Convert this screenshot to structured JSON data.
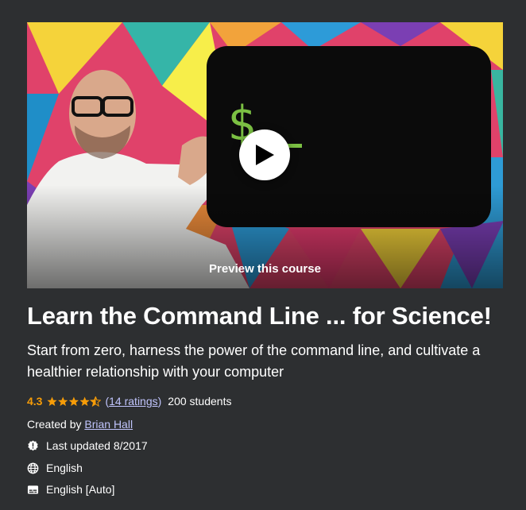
{
  "preview": {
    "label": "Preview this course",
    "terminal_prompt": "$"
  },
  "course": {
    "title": "Learn the Command Line ... for Science!",
    "subtitle": "Start from zero, harness the power of the command line, and cultivate a healthier relationship with your computer",
    "rating": "4.3",
    "rating_value": 4.3,
    "ratings_open": "(",
    "ratings_link": "14 ratings",
    "ratings_close": ")",
    "students": "200 students",
    "created_by_label": "Created by",
    "instructor": "Brian Hall",
    "last_updated": "Last updated 8/2017",
    "language": "English",
    "captions": "English [Auto]"
  },
  "colors": {
    "background": "#2d2f31",
    "star": "#f69c08",
    "link": "#c0c4fc",
    "terminal_green": "#7bc043"
  },
  "icons": {
    "play": "play-icon",
    "star": "star-icon",
    "updated": "alert-badge-icon",
    "language": "globe-icon",
    "captions": "closed-captions-icon"
  }
}
